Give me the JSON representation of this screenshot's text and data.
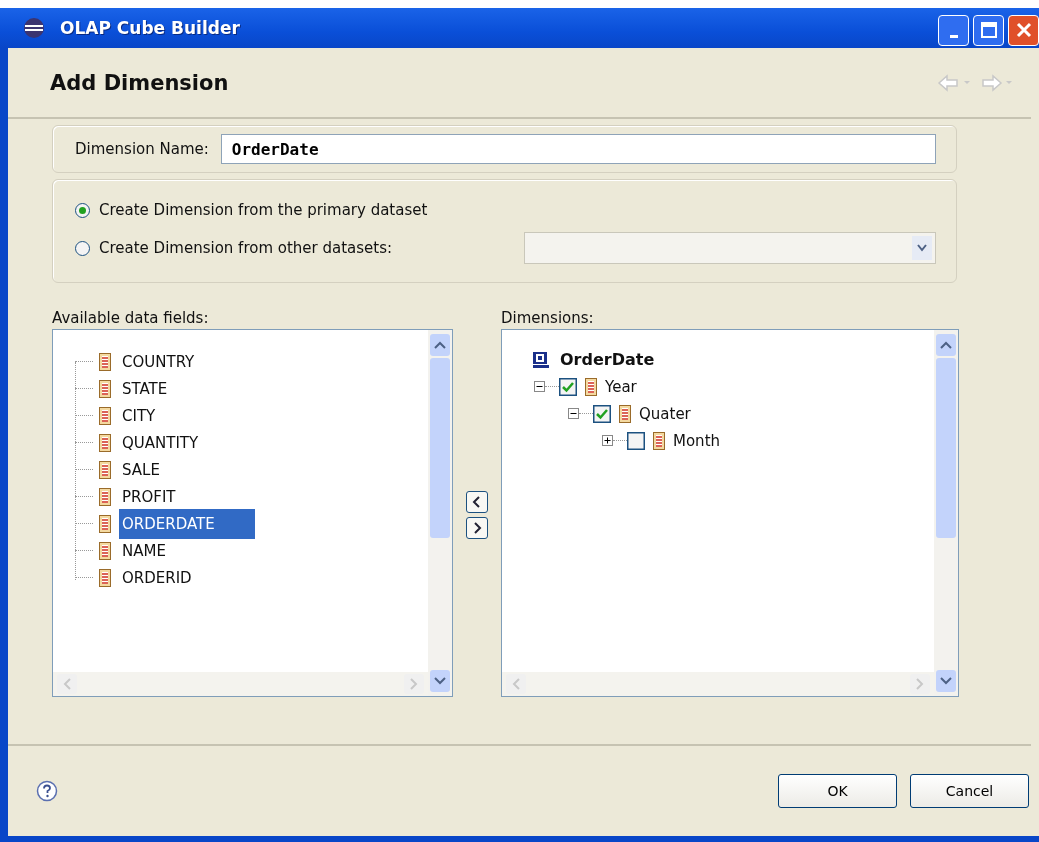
{
  "window": {
    "title": "OLAP Cube Builder"
  },
  "header": {
    "title": "Add Dimension",
    "nav": [
      {
        "kind": "back",
        "disabled": true
      },
      {
        "kind": "forward",
        "disabled": true
      }
    ]
  },
  "dimension_name": {
    "label": "Dimension Name:",
    "value": "OrderDate"
  },
  "source_options": [
    {
      "label": "Create Dimension from the primary dataset",
      "selected": true
    },
    {
      "label": "Create Dimension from other datasets:",
      "selected": false
    }
  ],
  "dataset_dropdown": {
    "disabled": true
  },
  "available_fields": {
    "label": "Available data fields:",
    "items": [
      {
        "label": "COUNTRY",
        "selected": false
      },
      {
        "label": "STATE",
        "selected": false
      },
      {
        "label": "CITY",
        "selected": false
      },
      {
        "label": "QUANTITY",
        "selected": false
      },
      {
        "label": "SALE",
        "selected": false
      },
      {
        "label": "PROFIT",
        "selected": false
      },
      {
        "label": "ORDERDATE",
        "selected": true
      },
      {
        "label": "NAME",
        "selected": false
      },
      {
        "label": "ORDERID",
        "selected": false
      }
    ]
  },
  "dimensions": {
    "label": "Dimensions:",
    "root": {
      "label": "OrderDate",
      "children": [
        {
          "label": "Year",
          "checked": true,
          "expanded": true,
          "children": [
            {
              "label": "Quater",
              "checked": true,
              "expanded": true,
              "children": [
                {
                  "label": "Month",
                  "checked": false,
                  "expanded": false
                }
              ]
            }
          ]
        }
      ]
    }
  },
  "buttons": [
    {
      "label": "OK"
    },
    {
      "label": "Cancel"
    }
  ]
}
